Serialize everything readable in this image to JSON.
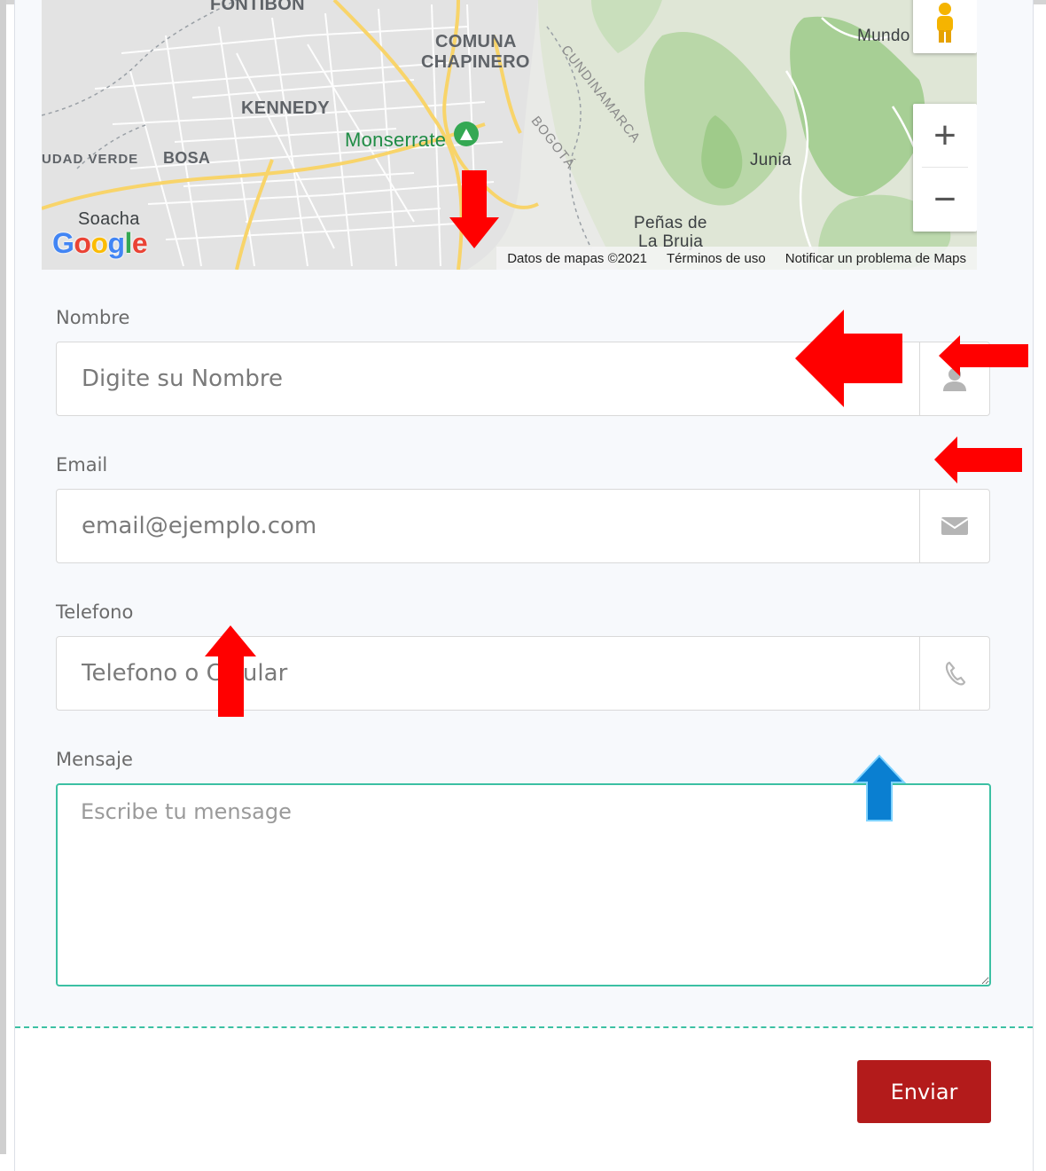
{
  "map": {
    "labels": {
      "fontibon": "FONTIBON",
      "comuna": "COMUNA",
      "chapinero": "CHAPINERO",
      "kennedy": "KENNEDY",
      "monserrate": "Monserrate",
      "ciudad_verde": "UDAD VERDE",
      "bosa": "BOSA",
      "soacha": "Soacha",
      "cundinamarca": "CUNDINAMARCA",
      "bogota": "BOGOTÁ",
      "junia": "Junia",
      "penas": "Peñas de",
      "bruja": "La Bruja",
      "mundo": "Mundo"
    },
    "zoom_in": "+",
    "zoom_out": "−",
    "google_logo": [
      "G",
      "o",
      "o",
      "g",
      "l",
      "e"
    ],
    "logo_colors": [
      "#4285F4",
      "#EA4335",
      "#FBBC05",
      "#4285F4",
      "#34A853",
      "#EA4335"
    ],
    "attribution": {
      "data": "Datos de mapas ©2021",
      "terms": "Términos de uso",
      "report": "Notificar un problema de Maps"
    }
  },
  "form": {
    "name": {
      "label": "Nombre",
      "placeholder": "Digite su Nombre",
      "icon": "user-icon"
    },
    "email": {
      "label": "Email",
      "placeholder": "email@ejemplo.com",
      "icon": "envelope-icon"
    },
    "phone": {
      "label": "Telefono",
      "placeholder": "Telefono o Celular",
      "icon": "phone-icon"
    },
    "message": {
      "label": "Mensaje",
      "placeholder": "Escribe tu mensage"
    },
    "submit_label": "Enviar"
  },
  "colors": {
    "accent": "#3cc0a3",
    "submit": "#b31b1b",
    "annotation_red": "#ff0000",
    "annotation_blue": "#0a7fd1"
  }
}
